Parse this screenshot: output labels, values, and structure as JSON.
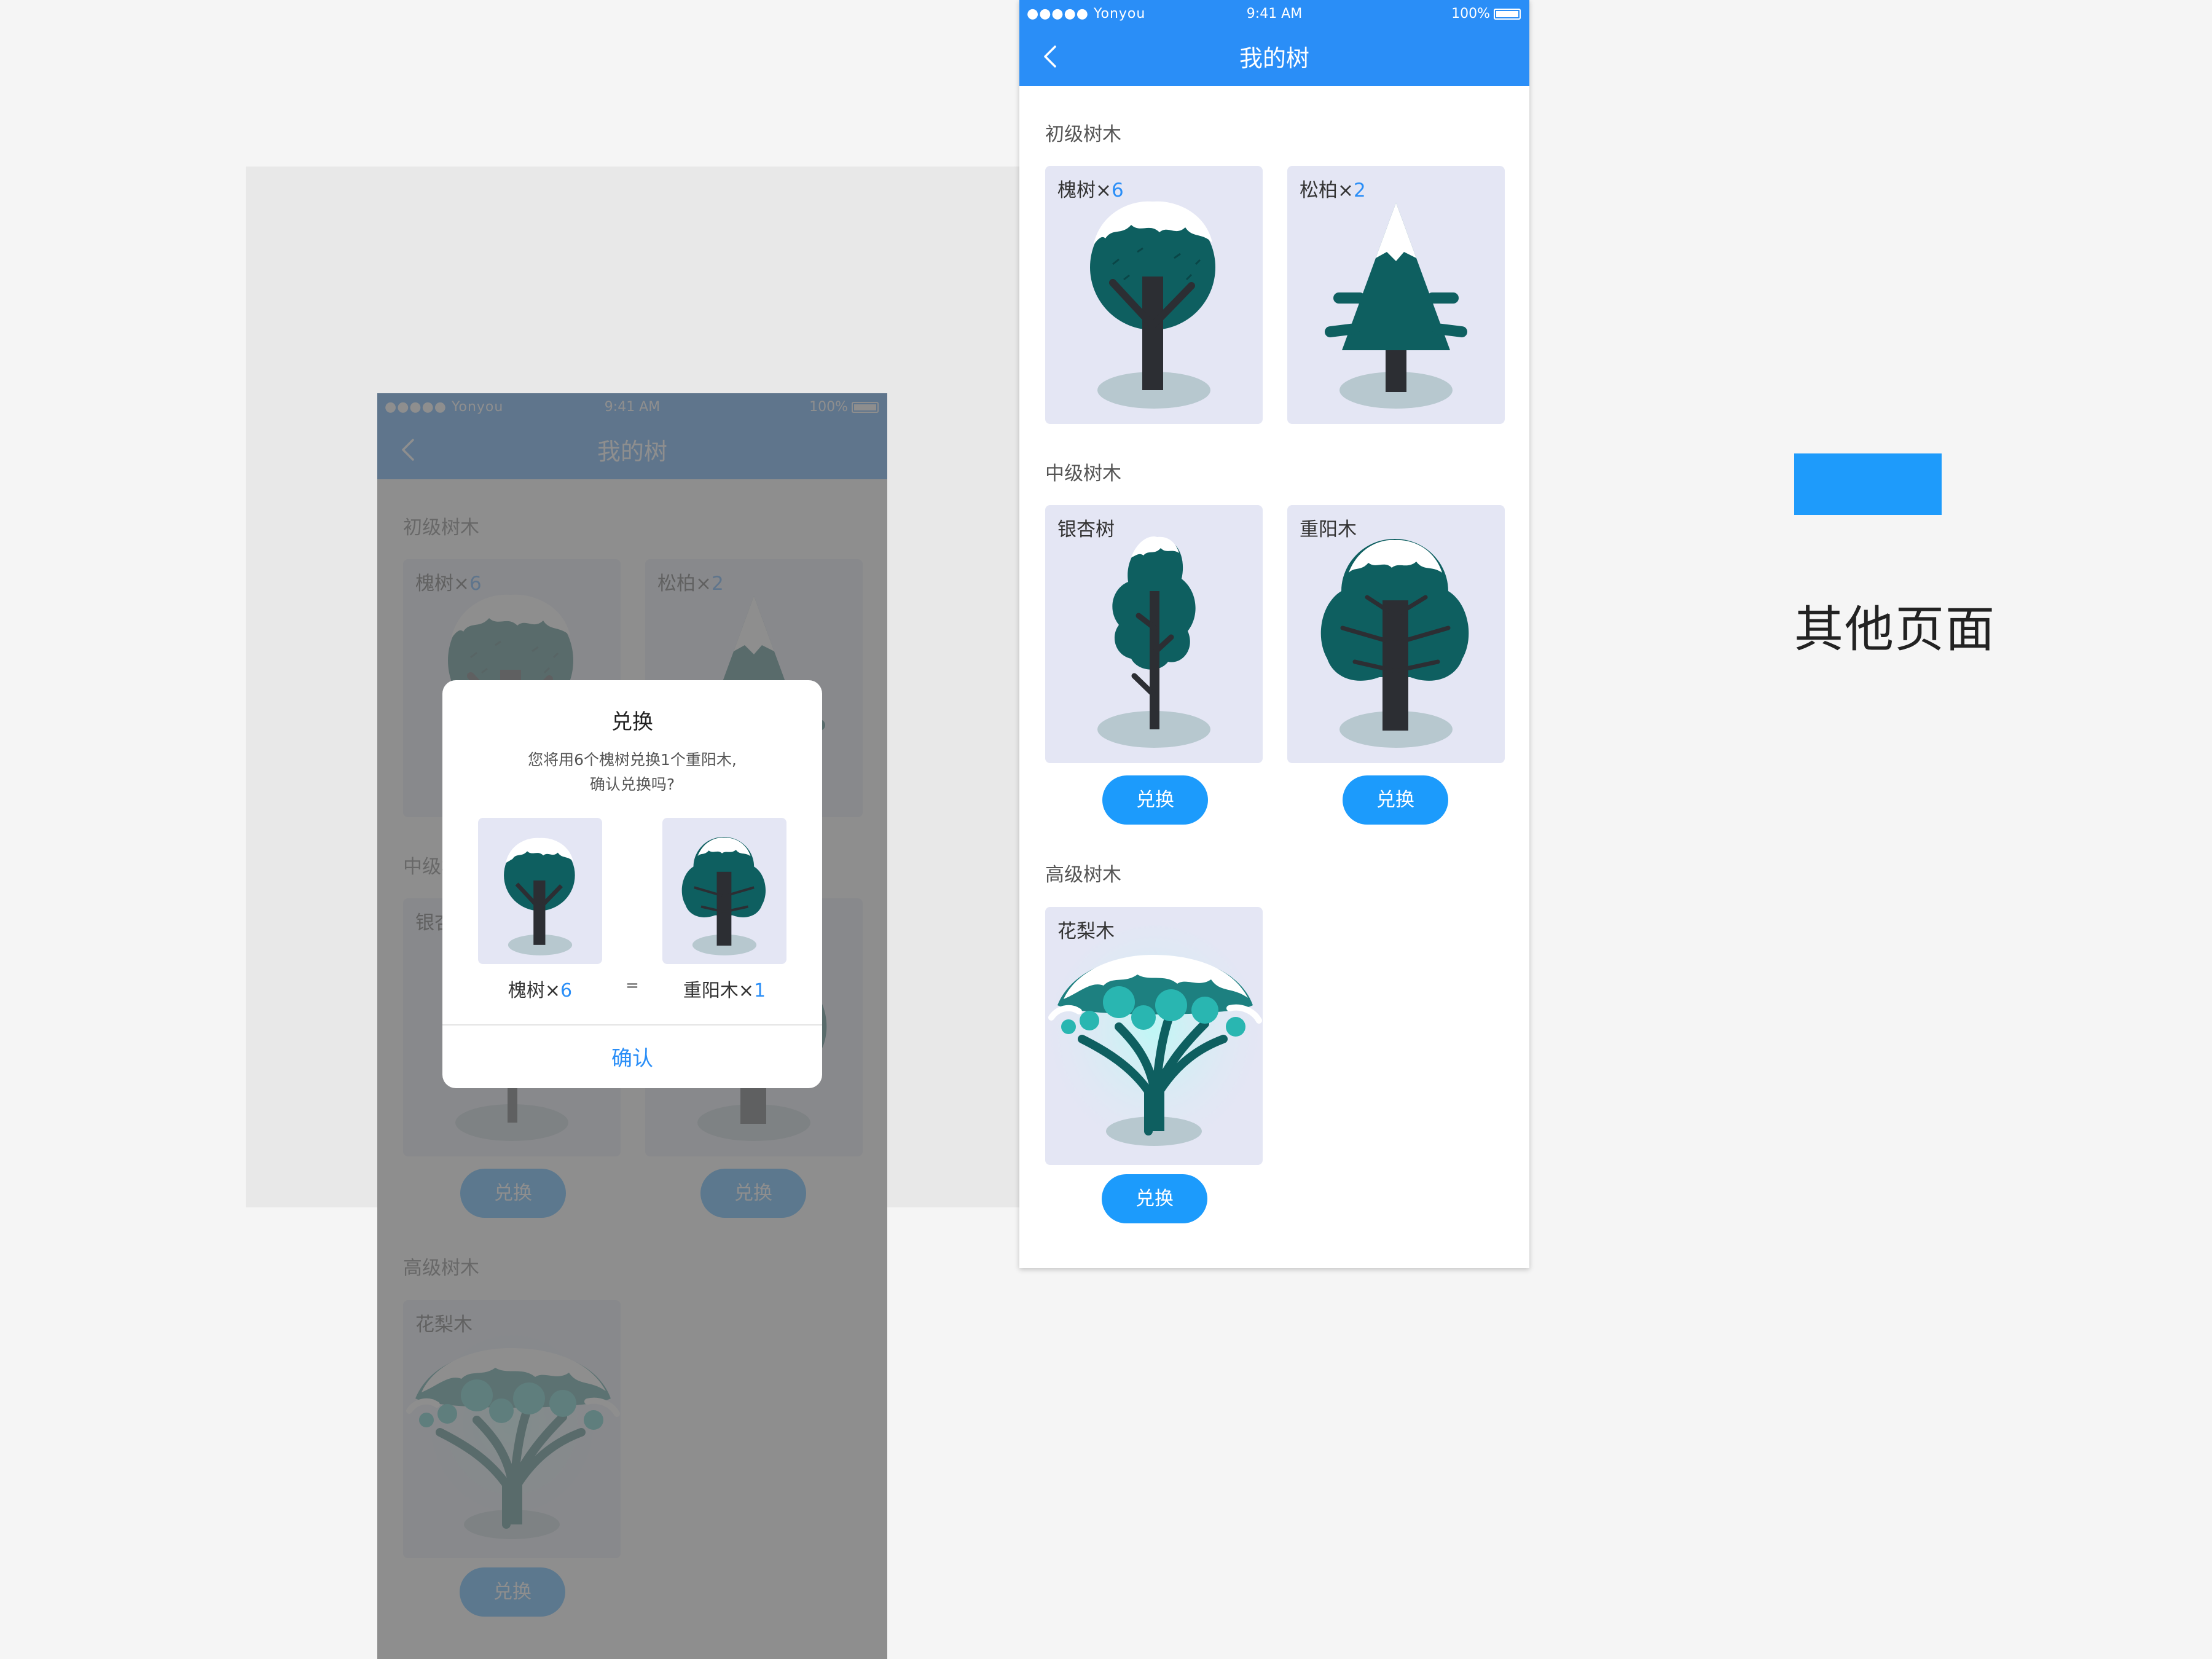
{
  "caption": "其他页面",
  "colors": {
    "accent": "#1e9bfb",
    "nav_blue": "#2a8ef7",
    "button_blue": "#1c9bfc",
    "card_bg": "#e4e6f4",
    "tree_teal": "#0e5f60",
    "trunk": "#2c2e33"
  },
  "screen": {
    "status": {
      "carrier": "●●●●● Yonyou",
      "time": "9:41 AM",
      "battery": "100%"
    },
    "nav": {
      "title": "我的树",
      "back_icon": "chevron-left-icon"
    },
    "sections": [
      {
        "title": "初级树木"
      },
      {
        "title": "中级树木"
      },
      {
        "title": "高级树木"
      }
    ],
    "trees": {
      "huaishu": {
        "name": "槐树",
        "mult": "×",
        "count": "6"
      },
      "songbai": {
        "name": "松柏",
        "mult": "×",
        "count": "2"
      },
      "yinxing": {
        "name": "银杏树"
      },
      "chongyang": {
        "name": "重阳木"
      },
      "hualimu": {
        "name": "花梨木"
      }
    },
    "exchange_label": "兑换"
  },
  "dialog": {
    "title": "兑换",
    "message_line1": "您将用6个槐树兑换1个重阳木,",
    "message_line2": "确认兑换吗?",
    "from": {
      "name": "槐树",
      "mult": "×",
      "count": "6"
    },
    "equals": "=",
    "to": {
      "name": "重阳木",
      "mult": "×",
      "count": "1"
    },
    "confirm": "确认"
  }
}
